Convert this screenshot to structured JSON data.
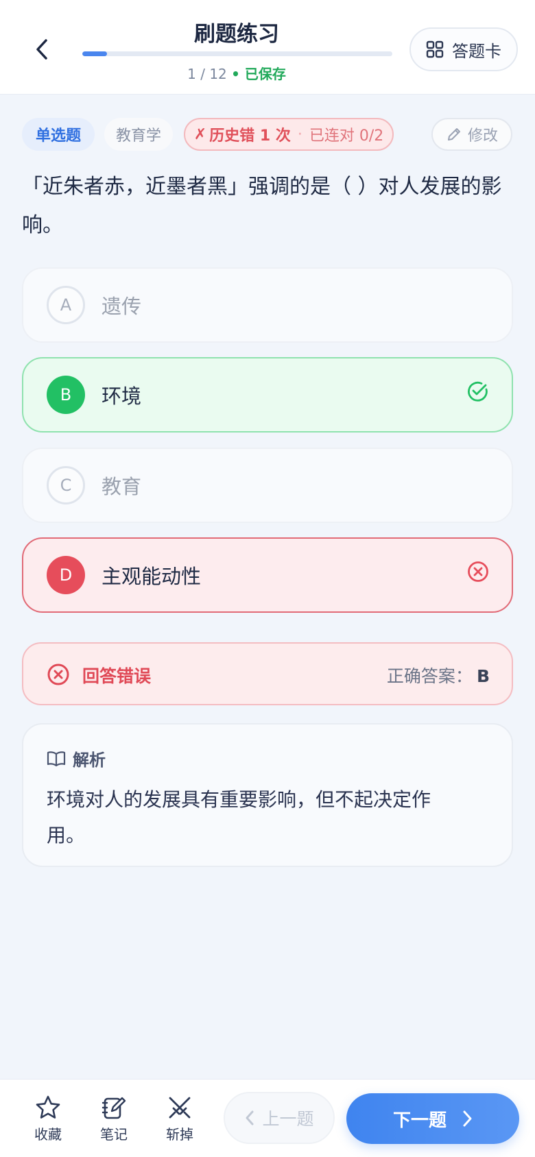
{
  "header": {
    "title": "刷题练习",
    "progress_current": "1",
    "progress_sep": " / ",
    "progress_total": "12",
    "progress_fraction": 0.08,
    "saved_label": "• 已保存",
    "answer_card_label": "答题卡",
    "back_icon": "chevron-left-icon",
    "grid_icon": "grid-icon"
  },
  "tags": {
    "type": "单选题",
    "subject": "教育学",
    "history_mark": "✗",
    "history_text": "历史错 1 次",
    "dot": "·",
    "streak_text": "已连对 0/2",
    "edit_label": "修改"
  },
  "question": {
    "text": "「近朱者赤，近墨者黑」强调的是（ ）对人发展的影响。"
  },
  "options": [
    {
      "letter": "A",
      "text": "遗传",
      "state": "neutral"
    },
    {
      "letter": "B",
      "text": "环境",
      "state": "correct"
    },
    {
      "letter": "C",
      "text": "教育",
      "state": "neutral"
    },
    {
      "letter": "D",
      "text": "主观能动性",
      "state": "wrong"
    }
  ],
  "result": {
    "label": "回答错误",
    "answer_prefix": "正确答案：",
    "answer": "B"
  },
  "analysis": {
    "title": "解析",
    "body": "环境对人的发展具有重要影响，但不起决定作用。"
  },
  "bottom": {
    "favorite_label": "收藏",
    "note_label": "笔记",
    "remove_label": "斩掉",
    "prev_label": "上一题",
    "next_label": "下一题"
  },
  "colors": {
    "accent": "#4a86ee",
    "correct": "#22c064",
    "wrong": "#e64d5b",
    "saved": "#21a95a"
  }
}
